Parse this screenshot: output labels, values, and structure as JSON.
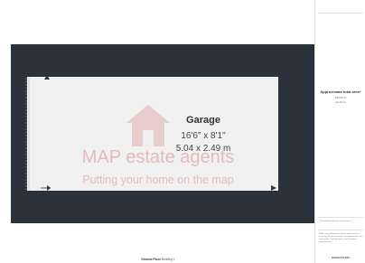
{
  "floorplan": {
    "room": {
      "name": "Garage",
      "dimension_imperial": "16'6\" x 8'1\"",
      "dimension_metric": "5.04 x 2.49 m"
    },
    "floor_label": "Ground Floor",
    "floor_sub": "Building 1",
    "watermark": {
      "company": "MAP estate agents",
      "tagline": "Putting your home on the map"
    }
  },
  "sidebar": {
    "area_title": "Approximate total area⁶",
    "area_imperial": "133.92 ft²",
    "area_metric": "12.44 m²",
    "footnote_heights": "(1) Excluding balconies and terraces",
    "disclaimer": "While every attempt has been made to ensure accuracy, all measurements are approximate and not to scale. This floor plan is for illustrative purposes only.",
    "brand": "GIRAFFE360"
  },
  "colors": {
    "walls": "#2b323b",
    "floor": "#f1f1f1",
    "watermark": "#c84646"
  }
}
